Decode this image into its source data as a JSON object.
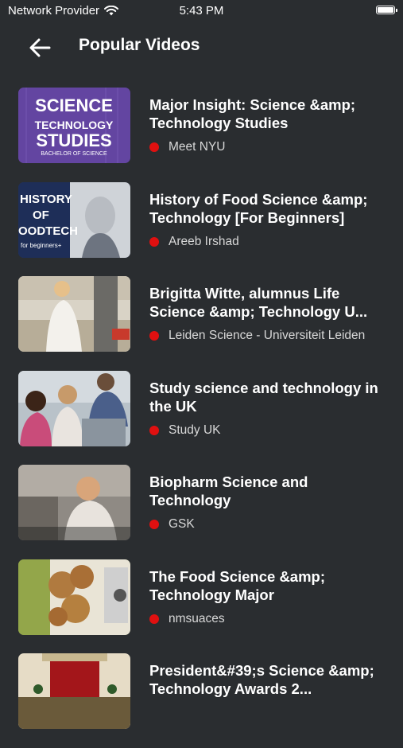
{
  "status": {
    "carrier": "Network Provider",
    "time": "5:43 PM"
  },
  "header": {
    "title": "Popular Videos"
  },
  "videos": [
    {
      "title": "Major Insight: Science &amp; Technology Studies",
      "channel": "Meet NYU",
      "thumb": {
        "l1": "SCIENCE",
        "l2": "TECHNOLOGY",
        "l3": "STUDIES",
        "l4": "BACHELOR OF SCIENCE"
      }
    },
    {
      "title": "History of Food Science &amp; Technology [For Beginners]",
      "channel": "Areeb Irshad",
      "thumb": {
        "l1": "HISTORY",
        "l2": "OF",
        "l3": "OODTECH",
        "l4": "for beginners+"
      }
    },
    {
      "title": "Brigitta Witte, alumnus Life Science &amp; Technology U...",
      "channel": "Leiden Science - Universiteit Leiden"
    },
    {
      "title": "Study science and technology in the UK",
      "channel": "Study UK"
    },
    {
      "title": "Biopharm Science and Technology",
      "channel": "GSK"
    },
    {
      "title": "The Food Science &amp; Technology Major",
      "channel": "nmsuaces"
    },
    {
      "title": "President&#39;s Science &amp; Technology Awards 2...",
      "channel": ""
    }
  ]
}
